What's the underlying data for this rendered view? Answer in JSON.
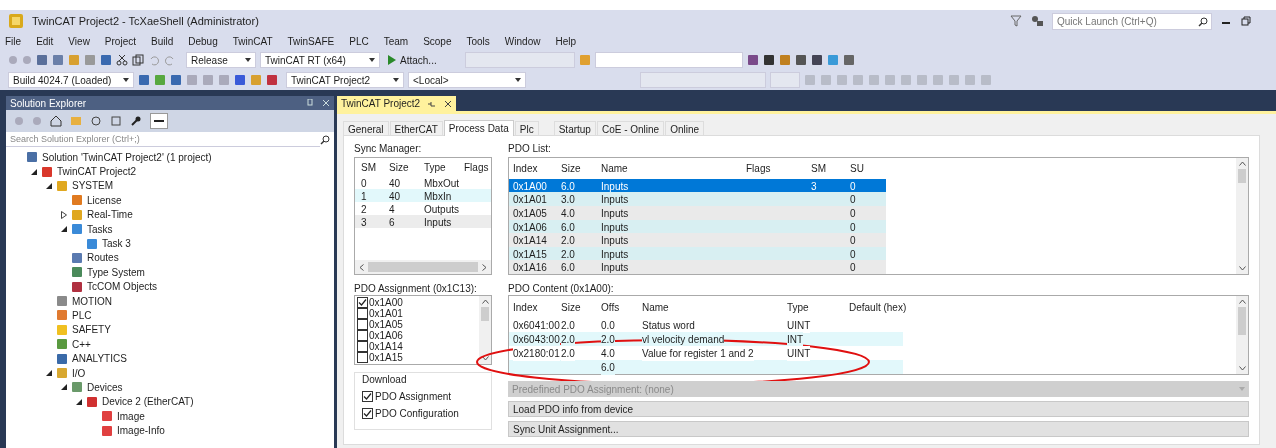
{
  "window": {
    "title": "TwinCAT Project2 - TcXaeShell (Administrator)",
    "quick_launch": {
      "placeholder": "Quick Launch (Ctrl+Q)"
    }
  },
  "menu": [
    "File",
    "Edit",
    "View",
    "Project",
    "Build",
    "Debug",
    "TwinCAT",
    "TwinSAFE",
    "PLC",
    "Team",
    "Scope",
    "Tools",
    "Window",
    "Help"
  ],
  "toolbar_1": {
    "combos": [
      {
        "value": "Release"
      },
      {
        "value": "TwinCAT RT (x64)"
      }
    ],
    "attach_button": "Attach..."
  },
  "toolbar_2": {
    "combos": [
      {
        "value": "Build 4024.7 (Loaded)"
      },
      {
        "value": "TwinCAT Project2"
      },
      {
        "value": "<Local>"
      }
    ]
  },
  "solution_explorer": {
    "title": "Solution Explorer",
    "search": {
      "placeholder": "Search Solution Explorer (Ctrl+;)"
    },
    "tree": [
      {
        "label": "Solution 'TwinCAT Project2' (1 project)",
        "color": "#4a6fa5",
        "children": [
          {
            "label": "TwinCAT Project2",
            "color": "#d9372b",
            "expanded": true,
            "children": [
              {
                "label": "SYSTEM",
                "color": "#e0a820",
                "expanded": true,
                "children": [
                  {
                    "label": "License",
                    "color": "#e07a20"
                  },
                  {
                    "label": "Real-Time",
                    "color": "#e0a820",
                    "expanded": false
                  },
                  {
                    "label": "Tasks",
                    "color": "#3a8ad8",
                    "expanded": true,
                    "children": [
                      {
                        "label": "Task 3",
                        "color": "#3a8ad8"
                      }
                    ]
                  },
                  {
                    "label": "Routes",
                    "color": "#5a7ab0"
                  },
                  {
                    "label": "Type System",
                    "color": "#4a8a5a"
                  },
                  {
                    "label": "TcCOM Objects",
                    "color": "#b03040"
                  }
                ]
              },
              {
                "label": "MOTION",
                "color": "#8a8a8a"
              },
              {
                "label": "PLC",
                "color": "#e07a30"
              },
              {
                "label": "SAFETY",
                "color": "#f0c020"
              },
              {
                "label": "C++",
                "color": "#5a9a40"
              },
              {
                "label": "ANALYTICS",
                "color": "#3a6aa8"
              },
              {
                "label": "I/O",
                "color": "#d8a830",
                "expanded": true,
                "children": [
                  {
                    "label": "Devices",
                    "color": "#6a9a6a",
                    "expanded": true,
                    "children": [
                      {
                        "label": "Device 2 (EtherCAT)",
                        "color": "#d03030",
                        "expanded": true,
                        "children": [
                          {
                            "label": "Image",
                            "color": "#e04040"
                          },
                          {
                            "label": "Image-Info",
                            "color": "#e04040"
                          }
                        ]
                      }
                    ]
                  }
                ]
              }
            ]
          }
        ]
      }
    ]
  },
  "document_tab": {
    "title": "TwinCAT Project2"
  },
  "tabs": [
    {
      "label": "General",
      "selected": false
    },
    {
      "label": "EtherCAT",
      "selected": false
    },
    {
      "label": "Process Data",
      "selected": true
    },
    {
      "label": "Plc",
      "selected": false
    },
    {
      "label": "Startup",
      "selected": false
    },
    {
      "label": "CoE - Online",
      "selected": false
    },
    {
      "label": "Online",
      "selected": false
    }
  ],
  "sync_manager": {
    "label": "Sync Manager:",
    "columns": [
      "SM",
      "Size",
      "Type",
      "Flags"
    ],
    "rows": [
      {
        "cells": [
          "0",
          "40",
          "MbxOut",
          ""
        ],
        "selected": false
      },
      {
        "cells": [
          "1",
          "40",
          "MbxIn",
          ""
        ],
        "selected": false
      },
      {
        "cells": [
          "2",
          "4",
          "Outputs",
          ""
        ],
        "selected": false
      },
      {
        "cells": [
          "3",
          "6",
          "Inputs",
          ""
        ],
        "selected": false
      }
    ]
  },
  "pdo_list": {
    "label": "PDO List:",
    "columns": [
      "Index",
      "Size",
      "Name",
      "Flags",
      "SM",
      "SU"
    ],
    "rows": [
      {
        "cells": [
          "0x1A00",
          "6.0",
          "Inputs",
          "",
          "3",
          "0"
        ],
        "selected": true
      },
      {
        "cells": [
          "0x1A01",
          "3.0",
          "Inputs",
          "",
          "",
          "0"
        ],
        "selected": false
      },
      {
        "cells": [
          "0x1A05",
          "4.0",
          "Inputs",
          "",
          "",
          "0"
        ],
        "selected": false
      },
      {
        "cells": [
          "0x1A06",
          "6.0",
          "Inputs",
          "",
          "",
          "0"
        ],
        "selected": false
      },
      {
        "cells": [
          "0x1A14",
          "2.0",
          "Inputs",
          "",
          "",
          "0"
        ],
        "selected": false
      },
      {
        "cells": [
          "0x1A15",
          "2.0",
          "Inputs",
          "",
          "",
          "0"
        ],
        "selected": false
      },
      {
        "cells": [
          "0x1A16",
          "6.0",
          "Inputs",
          "",
          "",
          "0"
        ],
        "selected": false
      }
    ]
  },
  "pdo_assignment": {
    "label": "PDO Assignment (0x1C13):",
    "items": [
      {
        "label": "0x1A00",
        "checked": true
      },
      {
        "label": "0x1A01",
        "checked": false
      },
      {
        "label": "0x1A05",
        "checked": false
      },
      {
        "label": "0x1A06",
        "checked": false
      },
      {
        "label": "0x1A14",
        "checked": false
      },
      {
        "label": "0x1A15",
        "checked": false
      }
    ]
  },
  "pdo_content": {
    "label": "PDO Content (0x1A00):",
    "columns": [
      "Index",
      "Size",
      "Offs",
      "Name",
      "Type",
      "Default (hex)"
    ],
    "rows": [
      {
        "cells": [
          "0x6041:00",
          "2.0",
          "0.0",
          "Status word",
          "UINT",
          ""
        ]
      },
      {
        "cells": [
          "0x6043:00",
          "2.0",
          "2.0",
          "vl velocity demand",
          "INT",
          ""
        ]
      },
      {
        "cells": [
          "0x2180:01",
          "2.0",
          "4.0",
          "Value for register 1 and 2",
          "UINT",
          ""
        ]
      },
      {
        "cells": [
          "",
          "",
          "6.0",
          "",
          "",
          ""
        ]
      }
    ]
  },
  "download": {
    "label": "Download",
    "options": [
      {
        "label": "PDO Assignment",
        "checked": true
      },
      {
        "label": "PDO Configuration",
        "checked": true
      }
    ]
  },
  "actions": [
    {
      "label": "Predefined PDO Assignment: (none)",
      "kind": "dropdown",
      "disabled": true
    },
    {
      "label": "Load PDO info from device",
      "kind": "button",
      "disabled": false
    },
    {
      "label": "Sync Unit Assignment...",
      "kind": "button",
      "disabled": false
    }
  ],
  "annotations": [
    {
      "kind": "ellipse",
      "color": "#e01010"
    }
  ]
}
